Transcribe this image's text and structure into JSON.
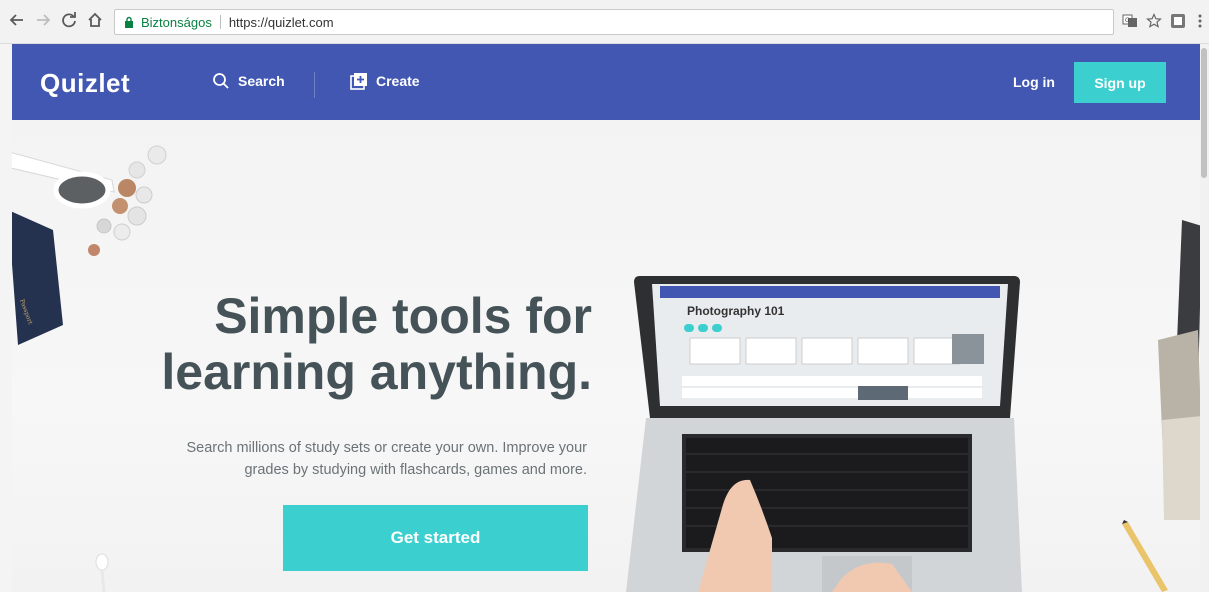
{
  "browser": {
    "back_icon": "arrow-left-icon",
    "forward_icon": "arrow-right-icon",
    "reload_icon": "reload-icon",
    "home_icon": "home-icon",
    "secure_label": "Biztonságos",
    "url": "https://quizlet.com",
    "translate_icon": "translate-icon",
    "bookmark_icon": "star-icon",
    "extension_icon": "extension-icon",
    "menu_icon": "kebab-menu-icon"
  },
  "header": {
    "logo": "Quizlet",
    "search_label": "Search",
    "create_label": "Create",
    "login_label": "Log in",
    "signup_label": "Sign up",
    "brand_color": "#4257b2",
    "accent_color": "#3ccfcf"
  },
  "hero": {
    "headline_line1": "Simple tools for",
    "headline_line2": "learning anything.",
    "subtext_line1": "Search millions of study sets or create your own. Improve your",
    "subtext_line2": "grades by studying with flashcards, games and more.",
    "cta_label": "Get started",
    "laptop_screen_title": "Photography 101"
  }
}
